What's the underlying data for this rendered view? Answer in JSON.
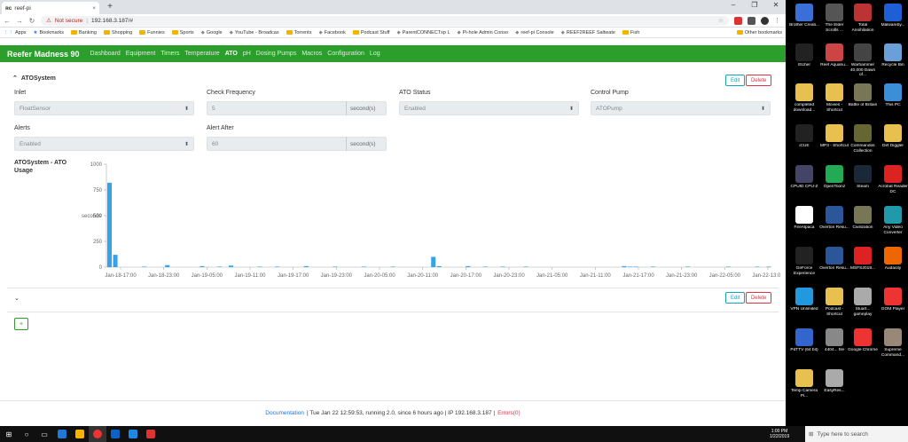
{
  "browser": {
    "tab_title": "reef-pi",
    "tab_close": "×",
    "new_tab": "+",
    "window_controls": [
      "–",
      "❐",
      "✕"
    ],
    "security_label": "Not secure",
    "url": "192.168.3.187/#",
    "bookmarks": [
      {
        "label": "Apps",
        "kind": "apps"
      },
      {
        "label": "Bookmarks",
        "kind": "star"
      },
      {
        "label": "Banking",
        "kind": "folder"
      },
      {
        "label": "Shopping",
        "kind": "folder"
      },
      {
        "label": "Funnies",
        "kind": "folder"
      },
      {
        "label": "Sports",
        "kind": "folder"
      },
      {
        "label": "Google",
        "kind": "site"
      },
      {
        "label": "YouTube - Broadcas",
        "kind": "site"
      },
      {
        "label": "Torrents",
        "kind": "folder"
      },
      {
        "label": "Facebook",
        "kind": "site"
      },
      {
        "label": "Podcast Stuff",
        "kind": "folder"
      },
      {
        "label": "ParentCONNECTxp L",
        "kind": "site"
      },
      {
        "label": "Pi-hole Admin Conso",
        "kind": "site"
      },
      {
        "label": "reef-pi Console",
        "kind": "site"
      },
      {
        "label": "REEF2REEF Saltwate",
        "kind": "site"
      },
      {
        "label": "Fish",
        "kind": "folder"
      }
    ],
    "other_bookmarks": "Other bookmarks"
  },
  "app": {
    "brand": "Reefer Madness 90",
    "nav": [
      "Dashboard",
      "Equipment",
      "Timers",
      "Temperature",
      "ATO",
      "pH",
      "Dosing Pumps",
      "Macros",
      "Configuration",
      "Log"
    ],
    "active_nav": "ATO"
  },
  "ato": {
    "name": "ATOSystem",
    "edit_label": "Edit",
    "delete_label": "Delete",
    "fields": {
      "inlet_label": "Inlet",
      "inlet_value": "FloatSensor",
      "check_frequency_label": "Check Frequency",
      "check_frequency_value": "5",
      "check_frequency_unit": "second(s)",
      "ato_status_label": "ATO Status",
      "ato_status_value": "Enabled",
      "control_pump_label": "Control Pump",
      "control_pump_value": "ATOPump",
      "alerts_label": "Alerts",
      "alerts_value": "Enabled",
      "alert_after_label": "Alert After",
      "alert_after_value": "60",
      "alert_after_unit": "second(s)"
    },
    "chart_title": "ATOSystem - ATO Usage"
  },
  "chart_data": {
    "type": "bar",
    "title": "ATOSystem - ATO Usage",
    "ylabel": "seconds",
    "xlabel": "",
    "ylim": [
      0,
      1000
    ],
    "yticks": [
      0,
      250,
      500,
      750,
      1000
    ],
    "x_tick_labels": [
      "Jan-18-17:00",
      "Jan-18-23:00",
      "Jan-19-05:00",
      "Jan-19-11:00",
      "Jan-19-17:00",
      "Jan-19-23:00",
      "Jan-20-05:00",
      "Jan-20-11:00",
      "Jan-20-17:00",
      "Jan-20-23:00",
      "Jan-21-05:00",
      "Jan-21-11:00",
      "Jan-21-17:00",
      "Jan-21-23:00",
      "Jan-22-05:00",
      "Jan-22-13:00"
    ],
    "bar_color": "#36a2eb",
    "values": [
      820,
      120,
      0,
      0,
      0,
      0,
      5,
      0,
      0,
      0,
      20,
      0,
      0,
      0,
      0,
      0,
      10,
      0,
      0,
      5,
      0,
      15,
      0,
      0,
      0,
      0,
      5,
      0,
      0,
      5,
      0,
      0,
      0,
      0,
      10,
      0,
      0,
      0,
      0,
      5,
      0,
      0,
      0,
      0,
      5,
      0,
      0,
      0,
      0,
      5,
      0,
      0,
      0,
      0,
      0,
      0,
      100,
      10,
      0,
      0,
      0,
      0,
      10,
      0,
      0,
      5,
      0,
      0,
      5,
      0,
      0,
      0,
      5,
      0,
      0,
      0,
      0,
      0,
      0,
      0,
      0,
      0,
      0,
      0,
      0,
      0,
      0,
      0,
      0,
      10,
      5,
      5,
      0,
      0,
      5,
      0,
      0,
      0,
      0,
      0,
      5,
      0,
      0,
      0,
      0,
      0,
      0,
      5,
      0,
      0,
      0,
      0,
      5,
      0,
      5
    ]
  },
  "second_section": {
    "collapse_icon": "⌄",
    "edit_label": "Edit",
    "delete_label": "Delete",
    "add_label": "+"
  },
  "footer": {
    "documentation": "Documentation",
    "status": "| Tue Jan 22 12:59:53, running 2.0, since 6 hours ago | IP 192.168.3.187 |",
    "errors": "Errors(0)"
  },
  "desktop_icons": [
    {
      "label": "Brother Creati...",
      "color": "#3a6fd8"
    },
    {
      "label": "The Elder Scrolls ...",
      "color": "#555"
    },
    {
      "label": "Total Annihilation",
      "color": "#b33"
    },
    {
      "label": "Malwareby...",
      "color": "#1e5fd6"
    },
    {
      "label": "Etcher",
      "color": "#222"
    },
    {
      "label": "Reef Aquariu...",
      "color": "#c44"
    },
    {
      "label": "Warhammer 40,000 Dawn of...",
      "color": "#444"
    },
    {
      "label": "Recycle Bin",
      "color": "#6aa0d8"
    },
    {
      "label": "completed download...",
      "color": "#e8c050"
    },
    {
      "label": "Movies - Shortcut",
      "color": "#e8c050"
    },
    {
      "label": "Battle of Britain",
      "color": "#775"
    },
    {
      "label": "This PC",
      "color": "#3a8fd8"
    },
    {
      "label": "iCUE",
      "color": "#222"
    },
    {
      "label": "MP3 - Shortcut",
      "color": "#e8c050"
    },
    {
      "label": "Commandos Collection",
      "color": "#663"
    },
    {
      "label": "Dirt Diggler",
      "color": "#e8c050"
    },
    {
      "label": "CPUID CPU-Z",
      "color": "#446"
    },
    {
      "label": "OpenToonz",
      "color": "#2a5"
    },
    {
      "label": "Steam",
      "color": "#1b2838"
    },
    {
      "label": "Acrobat Reader DC",
      "color": "#d22"
    },
    {
      "label": "FireAlpaca",
      "color": "#fff"
    },
    {
      "label": "Overton Resu...",
      "color": "#2b579a"
    },
    {
      "label": "Civilization",
      "color": "#775"
    },
    {
      "label": "Any Video Converter",
      "color": "#29a"
    },
    {
      "label": "GeForce Experience",
      "color": "#222"
    },
    {
      "label": "Overton Resu...",
      "color": "#2b579a"
    },
    {
      "label": "MSFS2019...",
      "color": "#d22"
    },
    {
      "label": "Audacity",
      "color": "#e60"
    },
    {
      "label": "VPN Unlimited",
      "color": "#29d"
    },
    {
      "label": "Podcast - Shortcut",
      "color": "#e8c050"
    },
    {
      "label": "Stuart... gameplay",
      "color": "#aaa"
    },
    {
      "label": "GOM Player",
      "color": "#e33"
    },
    {
      "label": "PdTTV (64 bit)",
      "color": "#36c"
    },
    {
      "label": "4404... file",
      "color": "#888"
    },
    {
      "label": "Google Chrome",
      "color": "#e33"
    },
    {
      "label": "Supreme Command...",
      "color": "#987"
    },
    {
      "label": "Temp Camera Pi...",
      "color": "#e8c050"
    },
    {
      "label": "EasyRes...",
      "color": "#aaa"
    }
  ],
  "taskbar": {
    "search_placeholder": "Type here to search",
    "time": "1:00 PM",
    "date": "1/22/2019"
  }
}
